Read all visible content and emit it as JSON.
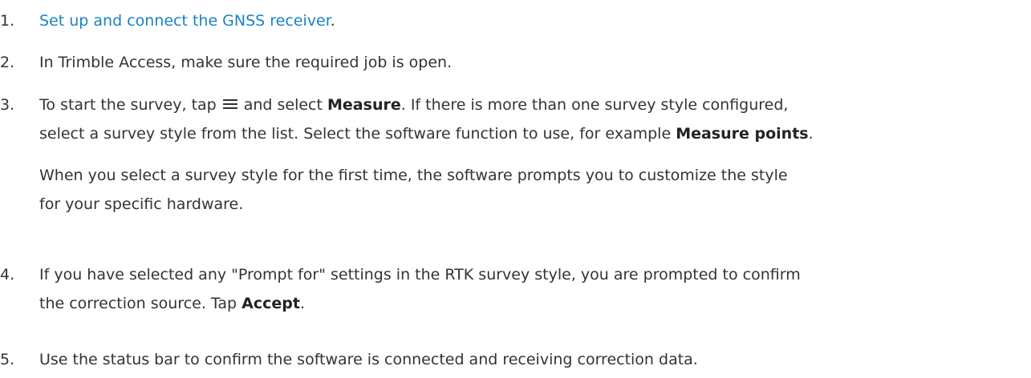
{
  "steps": [
    {
      "number": "1.",
      "link_text": "Set up and connect the GNSS receiver",
      "trailing": "."
    },
    {
      "number": "2.",
      "text": "In Trimble Access, make sure the required job is open."
    },
    {
      "number": "3.",
      "line1_pre": "To start the survey, tap",
      "icon": "hamburger-menu-icon",
      "line1_mid": "and select",
      "bold_measure": "Measure",
      "line1_post": ". If there is more than one survey style configured,",
      "line2_pre": "select a survey style from the list. Select the software function to use, for example",
      "bold_measure_points": "Measure points",
      "line2_post": ".",
      "sub_line1": "When you select a survey style for the first time, the software prompts you to customize the style",
      "sub_line2": "for your specific hardware."
    },
    {
      "number": "4.",
      "line1": "If you have selected any \"Prompt for\" settings in the RTK survey style, you are prompted to confirm",
      "line2_pre": "the correction source. Tap",
      "bold_accept": "Accept",
      "line2_post": "."
    },
    {
      "number": "5.",
      "text": "Use the status bar to confirm the software is connected and receiving correction data."
    }
  ],
  "colors": {
    "text": "#333333",
    "link": "#1a82c4"
  }
}
